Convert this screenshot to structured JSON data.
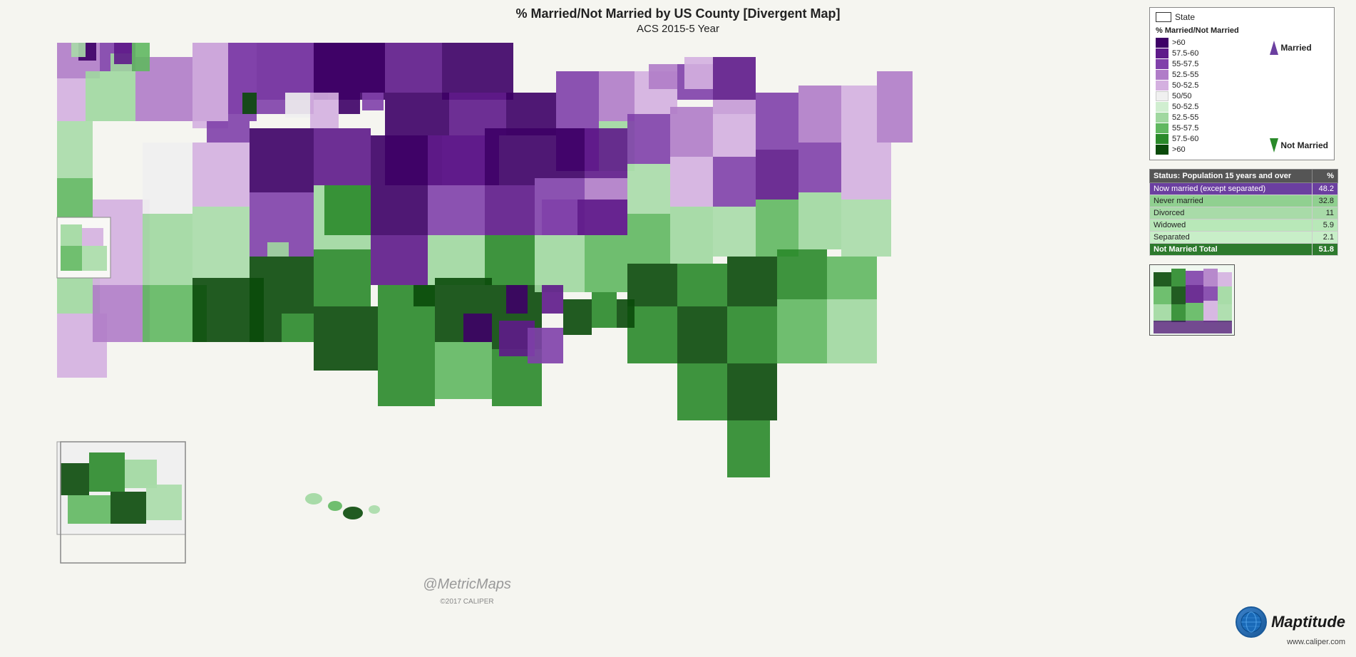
{
  "title": {
    "line1": "% Married/Not Married by US County [Divergent Map]",
    "line2": "ACS 2015-5 Year"
  },
  "legend": {
    "state_label": "State",
    "pct_label": "% Married/Not Married",
    "married_label": "Married",
    "not_married_label": "Not Married",
    "items_married": [
      {
        "label": ">60",
        "color": "#3d0066"
      },
      {
        "label": "57.5-60",
        "color": "#5e1a8a"
      },
      {
        "label": "55-57.5",
        "color": "#8040aa"
      },
      {
        "label": "52.5-55",
        "color": "#b07cc8"
      },
      {
        "label": "50-52.5",
        "color": "#d4b0e0"
      },
      {
        "label": "50/50",
        "color": "#f0f0f0"
      }
    ],
    "items_not_married": [
      {
        "label": "50-52.5",
        "color": "#d0eed0"
      },
      {
        "label": "52.5-55",
        "color": "#a0d8a0"
      },
      {
        "label": "55-57.5",
        "color": "#60b860"
      },
      {
        "label": "57.5-60",
        "color": "#2a8a2a"
      },
      {
        "label": ">60",
        "color": "#0a4a0a"
      }
    ]
  },
  "status_table": {
    "col1_header": "Status: Population 15 years and over",
    "col2_header": "%",
    "rows": [
      {
        "label": "Now married (except separated)",
        "value": "48.2",
        "class": "row-married"
      },
      {
        "label": "Never married",
        "value": "32.8",
        "class": "row-never"
      },
      {
        "label": "Divorced",
        "value": "11",
        "class": "row-divorced"
      },
      {
        "label": "Widowed",
        "value": "5.9",
        "class": "row-widowed"
      },
      {
        "label": "Separated",
        "value": "2.1",
        "class": "row-separated"
      },
      {
        "label": "Not Married Total",
        "value": "51.8",
        "class": "row-total"
      }
    ]
  },
  "watermark": "@MetricMaps",
  "copyright": "©2017 CALIPER",
  "maptitude": {
    "name": "Maptitude",
    "url": "www.caliper.com"
  }
}
